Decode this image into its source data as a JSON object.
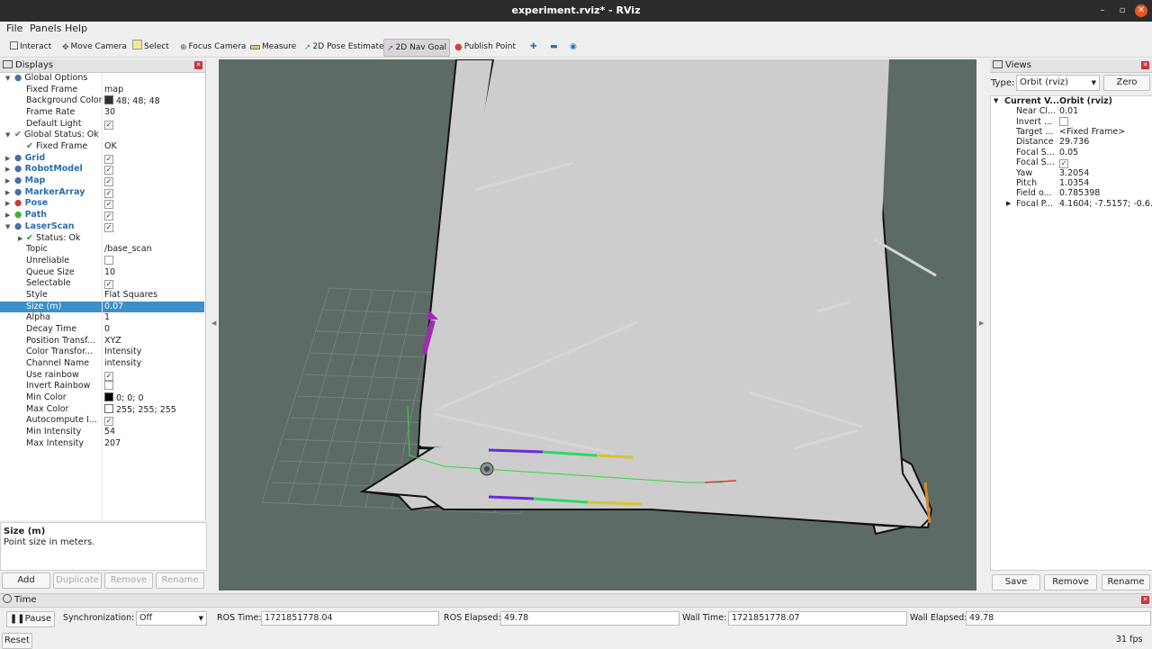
{
  "window": {
    "title": "experiment.rviz* - RViz"
  },
  "menu": [
    "File",
    "Panels",
    "Help"
  ],
  "toolbar": {
    "tools": [
      "Interact",
      "Move Camera",
      "Select",
      "Focus Camera",
      "Measure",
      "2D Pose Estimate",
      "2D Nav Goal",
      "Publish Point"
    ],
    "active_tool": "2D Nav Goal"
  },
  "displays": {
    "title": "Displays",
    "rows": [
      {
        "label": "Global Options",
        "value": "",
        "indent": 0,
        "expanded": true,
        "icon": "gear-icon"
      },
      {
        "label": "Fixed Frame",
        "value": "map",
        "indent": 1
      },
      {
        "label": "Background Color",
        "value": "48; 48; 48",
        "indent": 1,
        "swatch": "#303030"
      },
      {
        "label": "Frame Rate",
        "value": "30",
        "indent": 1
      },
      {
        "label": "Default Light",
        "value": "",
        "indent": 1,
        "checkbox": true
      },
      {
        "label": "Global Status: Ok",
        "value": "",
        "indent": 0,
        "expanded": true,
        "status": true
      },
      {
        "label": "Fixed Frame",
        "value": "OK",
        "indent": 1,
        "status": true
      },
      {
        "label": "Grid",
        "value": "",
        "indent": 0,
        "collapsed": true,
        "plugin": true,
        "checkbox": true,
        "icon": "grid-icon"
      },
      {
        "label": "RobotModel",
        "value": "",
        "indent": 0,
        "collapsed": true,
        "plugin": true,
        "checkbox": true,
        "icon": "robot-icon"
      },
      {
        "label": "Map",
        "value": "",
        "indent": 0,
        "collapsed": true,
        "plugin": true,
        "checkbox": true,
        "icon": "map-icon"
      },
      {
        "label": "MarkerArray",
        "value": "",
        "indent": 0,
        "collapsed": true,
        "plugin": true,
        "checkbox": true,
        "icon": "marker-icon"
      },
      {
        "label": "Pose",
        "value": "",
        "indent": 0,
        "collapsed": true,
        "plugin": true,
        "checkbox": true,
        "icon": "pose-icon"
      },
      {
        "label": "Path",
        "value": "",
        "indent": 0,
        "collapsed": true,
        "plugin": true,
        "checkbox": true,
        "icon": "path-icon"
      },
      {
        "label": "LaserScan",
        "value": "",
        "indent": 0,
        "expanded": true,
        "plugin": true,
        "checkbox": true,
        "icon": "laser-icon"
      },
      {
        "label": "Status: Ok",
        "value": "",
        "indent": 1,
        "collapsed": true,
        "status": true
      },
      {
        "label": "Topic",
        "value": "/base_scan",
        "indent": 1
      },
      {
        "label": "Unreliable",
        "value": "",
        "indent": 1,
        "checkbox": false
      },
      {
        "label": "Queue Size",
        "value": "10",
        "indent": 1
      },
      {
        "label": "Selectable",
        "value": "",
        "indent": 1,
        "checkbox": true
      },
      {
        "label": "Style",
        "value": "Flat Squares",
        "indent": 1
      },
      {
        "label": "Size (m)",
        "value": "0.07",
        "indent": 1,
        "selected": true
      },
      {
        "label": "Alpha",
        "value": "1",
        "indent": 1
      },
      {
        "label": "Decay Time",
        "value": "0",
        "indent": 1
      },
      {
        "label": "Position Transf...",
        "value": "XYZ",
        "indent": 1
      },
      {
        "label": "Color Transfor...",
        "value": "Intensity",
        "indent": 1
      },
      {
        "label": "Channel Name",
        "value": "intensity",
        "indent": 1
      },
      {
        "label": "Use rainbow",
        "value": "",
        "indent": 1,
        "checkbox": true
      },
      {
        "label": "Invert Rainbow",
        "value": "",
        "indent": 1,
        "checkbox": false
      },
      {
        "label": "Min Color",
        "value": "0; 0; 0",
        "indent": 1,
        "swatch": "#000000"
      },
      {
        "label": "Max Color",
        "value": "255; 255; 255",
        "indent": 1,
        "swatch": "#ffffff"
      },
      {
        "label": "Autocompute I...",
        "value": "",
        "indent": 1,
        "checkbox": true
      },
      {
        "label": "Min Intensity",
        "value": "54",
        "indent": 1
      },
      {
        "label": "Max Intensity",
        "value": "207",
        "indent": 1
      }
    ],
    "description": {
      "title": "Size (m)",
      "text": "Point size in meters."
    },
    "buttons": {
      "add": "Add",
      "duplicate": "Duplicate",
      "remove": "Remove",
      "rename": "Rename"
    }
  },
  "views": {
    "title": "Views",
    "type_label": "Type:",
    "type_value": "Orbit (rviz)",
    "zero": "Zero",
    "current_label": "Current V...",
    "current_value": "Orbit (rviz)",
    "rows": [
      {
        "label": "Near Cl...",
        "value": "0.01"
      },
      {
        "label": "Invert ...",
        "value": "",
        "checkbox": false
      },
      {
        "label": "Target ...",
        "value": "<Fixed Frame>"
      },
      {
        "label": "Distance",
        "value": "29.736"
      },
      {
        "label": "Focal S...",
        "value": "0.05"
      },
      {
        "label": "Focal S...",
        "value": "",
        "checkbox": true
      },
      {
        "label": "Yaw",
        "value": "3.2054"
      },
      {
        "label": "Pitch",
        "value": "1.0354"
      },
      {
        "label": "Field o...",
        "value": "0.785398"
      },
      {
        "label": "Focal P...",
        "value": "4.1604; -7.5157; -0.6...",
        "collapsed": true
      }
    ],
    "buttons": {
      "save": "Save",
      "remove": "Remove",
      "rename": "Rename"
    }
  },
  "time": {
    "title": "Time",
    "pause": "Pause",
    "sync_label": "Synchronization:",
    "sync_value": "Off",
    "ros_time_label": "ROS Time:",
    "ros_time": "1721851778.04",
    "ros_elapsed_label": "ROS Elapsed:",
    "ros_elapsed": "49.78",
    "wall_time_label": "Wall Time:",
    "wall_time": "1721851778.07",
    "wall_elapsed_label": "Wall Elapsed:",
    "wall_elapsed": "49.78",
    "reset": "Reset",
    "fps": "31 fps"
  }
}
